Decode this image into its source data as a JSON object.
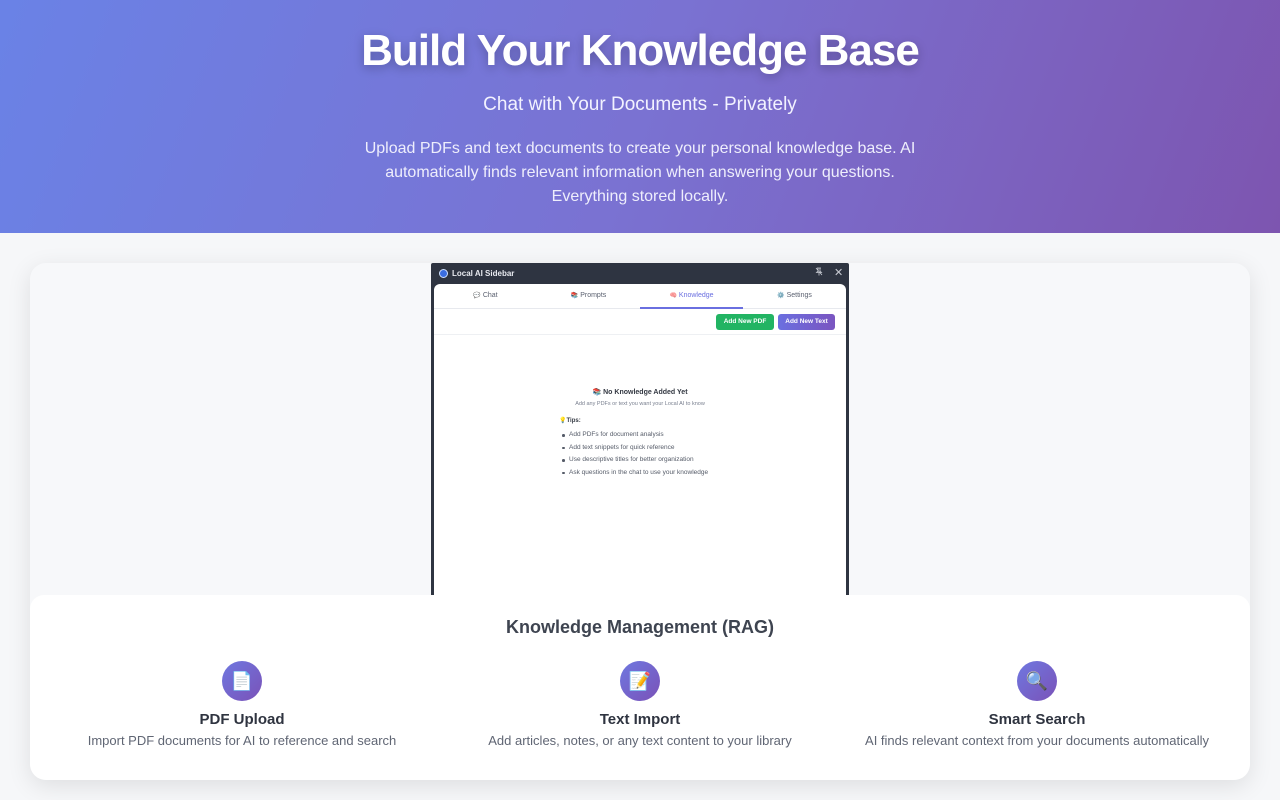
{
  "hero": {
    "title": "Build Your Knowledge Base",
    "subtitle": "Chat with Your Documents - Privately",
    "description": "Upload PDFs and text documents to create your personal knowledge base. AI automatically finds relevant information when answering your questions. Everything stored locally."
  },
  "window": {
    "title": "Local AI Sidebar",
    "pin_icon": "pin-icon",
    "close_icon": "✕",
    "tabs": [
      {
        "icon": "💬",
        "label": "Chat",
        "active": false
      },
      {
        "icon": "📚",
        "label": "Prompts",
        "active": false
      },
      {
        "icon": "🧠",
        "label": "Knowledge",
        "active": true
      },
      {
        "icon": "⚙️",
        "label": "Settings",
        "active": false
      }
    ],
    "add_pdf_label": "Add New PDF",
    "add_text_label": "Add New Text",
    "empty_title": "📚 No Knowledge Added Yet",
    "empty_subtitle": "Add any PDFs or text you want your Local AI to know",
    "tips_label": "💡Tips:",
    "tips": [
      "Add PDFs for document analysis",
      "Add text snippets for quick reference",
      "Use descriptive titles for better organization",
      "Ask questions in the chat to use your knowledge"
    ]
  },
  "features": {
    "title": "Knowledge Management (RAG)",
    "items": [
      {
        "icon": "📄",
        "title": "PDF Upload",
        "description": "Import PDF documents for AI to reference and search"
      },
      {
        "icon": "📝",
        "title": "Text Import",
        "description": "Add articles, notes, or any text content to your library"
      },
      {
        "icon": "🔍",
        "title": "Smart Search",
        "description": "AI finds relevant context from your documents automatically"
      }
    ]
  },
  "colors": {
    "accent": "#6a6fe0",
    "green_button": "#22b463",
    "purple_button": "#7a55c0",
    "hero_start": "#6a82e6",
    "hero_end": "#7d55b0"
  }
}
